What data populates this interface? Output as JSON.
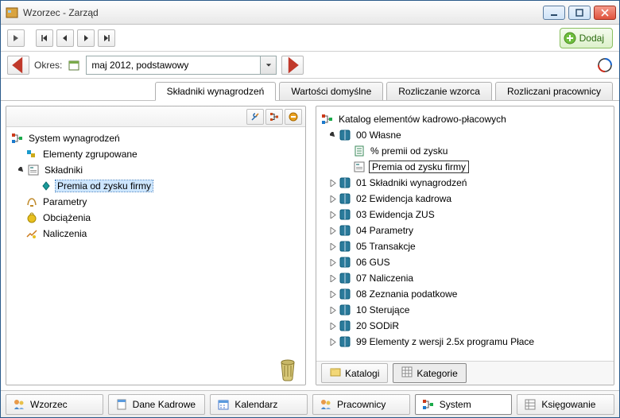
{
  "window": {
    "title": "Wzorzec - Zarząd"
  },
  "toolbar": {
    "add_label": "Dodaj",
    "okres_label": "Okres:",
    "period_value": "maj 2012, podstawowy"
  },
  "tabs": {
    "skladniki": "Składniki wynagrodzeń",
    "wartosci": "Wartości domyślne",
    "rozliczanie": "Rozliczanie wzorca",
    "pracownicy": "Rozliczani pracownicy"
  },
  "left_tree": {
    "root": "System wynagrodzeń",
    "elementy": "Elementy zgrupowane",
    "skladniki": "Składniki",
    "premia": "Premia od zysku firmy",
    "parametry": "Parametry",
    "obciazenia": "Obciążenia",
    "naliczenia": "Naliczenia"
  },
  "right_tree": {
    "header": "Katalog elementów kadrowo-płacowych",
    "wlasne": "00 Własne",
    "pct_premii": "% premii od zysku",
    "premia": "Premia od zysku firmy",
    "items": [
      "01 Składniki wynagrodzeń",
      "02 Ewidencja kadrowa",
      "03 Ewidencja ZUS",
      "04 Parametry",
      "05 Transakcje",
      "06 GUS",
      "07 Naliczenia",
      "08 Zeznania podatkowe",
      "10 Sterujące",
      "20 SODiR",
      "99 Elementy z wersji 2.5x programu Płace"
    ]
  },
  "pane_tabs": {
    "katalogi": "Katalogi",
    "kategorie": "Kategorie"
  },
  "bottom": {
    "wzorzec": "Wzorzec",
    "dane": "Dane Kadrowe",
    "kalendarz": "Kalendarz",
    "pracownicy": "Pracownicy",
    "system": "System",
    "ksiegowanie": "Księgowanie"
  }
}
